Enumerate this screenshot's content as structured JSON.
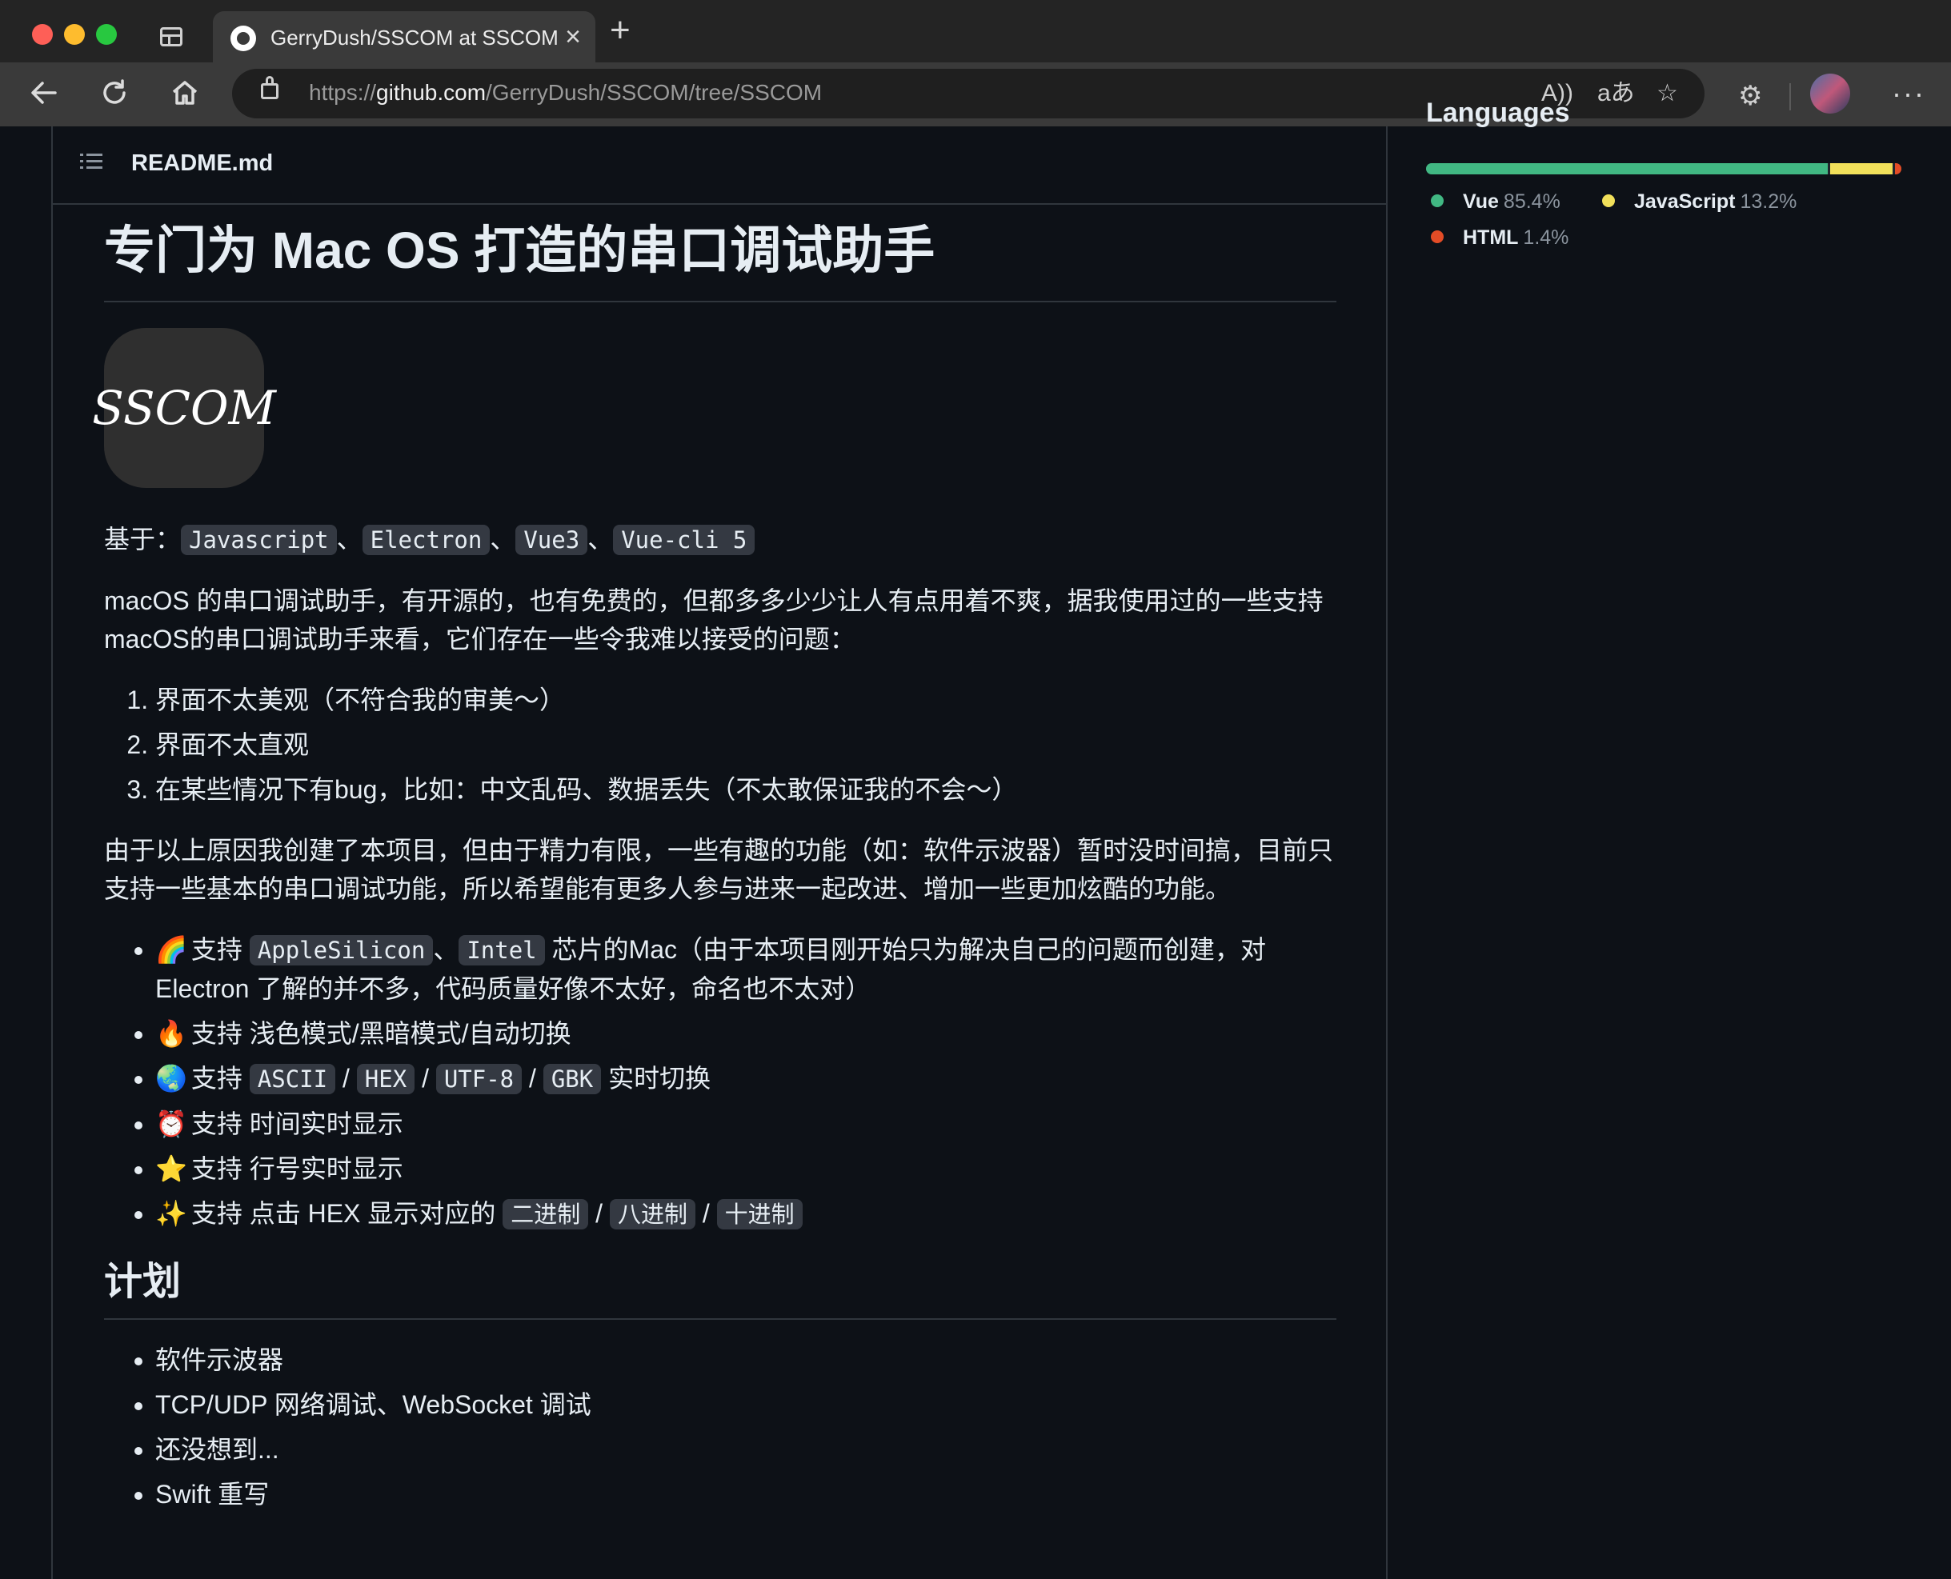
{
  "browser": {
    "tab_title": "GerryDush/SSCOM at SSCOM",
    "tab_close": "×",
    "new_tab": "+",
    "url_scheme": "https://",
    "url_host": "github.com",
    "url_path": "/GerryDush/SSCOM/tree/SSCOM",
    "read_aloud_glyph": "A))",
    "translate_glyph": "aあ",
    "favorites_glyph": "☆",
    "extensions_glyph": "⚙",
    "more_glyph": "···"
  },
  "readme": {
    "filename": "README.md",
    "title": "专门为 Mac OS 打造的串口调试助手",
    "logo_text": "SSCOM",
    "based_on_label": "基于：",
    "tech": [
      "Javascript",
      "Electron",
      "Vue3",
      "Vue-cli 5"
    ],
    "sep": "、",
    "intro": "macOS 的串口调试助手，有开源的，也有免费的，但都多多少少让人有点用着不爽，据我使用过的一些支持macOS的串口调试助手来看，它们存在一些令我难以接受的问题：",
    "problems": [
      "界面不太美观（不符合我的审美～）",
      "界面不太直观",
      "在某些情况下有bug，比如：中文乱码、数据丢失（不太敢保证我的不会～）"
    ],
    "para2": "由于以上原因我创建了本项目，但由于精力有限，一些有趣的功能（如：软件示波器）暂时没时间搞，目前只支持一些基本的串口调试功能，所以希望能有更多人参与进来一起改进、增加一些更加炫酷的功能。",
    "features": {
      "f1": {
        "emoji": "🌈",
        "pre": "支持 ",
        "code1": "AppleSilicon",
        "sep": "、",
        "code2": "Intel",
        "post": " 芯片的Mac（由于本项目刚开始只为解决自己的问题而创建，对Electron 了解的并不多，代码质量好像不太好，命名也不太对）"
      },
      "f2": {
        "emoji": "🔥",
        "text": "支持 浅色模式/黑暗模式/自动切换"
      },
      "f3": {
        "emoji": "🌏",
        "pre": "支持 ",
        "codes": [
          "ASCII",
          "HEX",
          "UTF-8",
          "GBK"
        ],
        "slash": " / ",
        "post": " 实时切换"
      },
      "f4": {
        "emoji": "⏰",
        "text": "支持 时间实时显示"
      },
      "f5": {
        "emoji": "⭐",
        "text": "支持 行号实时显示"
      },
      "f6": {
        "emoji": "✨",
        "pre": "支持 点击 HEX 显示对应的 ",
        "codes": [
          "二进制",
          "八进制",
          "十进制"
        ],
        "slash": " / "
      }
    },
    "plan_heading": "计划",
    "plans": [
      "软件示波器",
      "TCP/UDP 网络调试、WebSocket 调试",
      "还没想到...",
      "Swift 重写"
    ]
  },
  "languages": {
    "heading": "Languages",
    "items": [
      {
        "name": "Vue",
        "pct": "85.4%",
        "value": 85.4,
        "color": "#41b883"
      },
      {
        "name": "JavaScript",
        "pct": "13.2%",
        "value": 13.2,
        "color": "#f1e05a"
      },
      {
        "name": "HTML",
        "pct": "1.4%",
        "value": 1.4,
        "color": "#e34c26"
      }
    ]
  }
}
